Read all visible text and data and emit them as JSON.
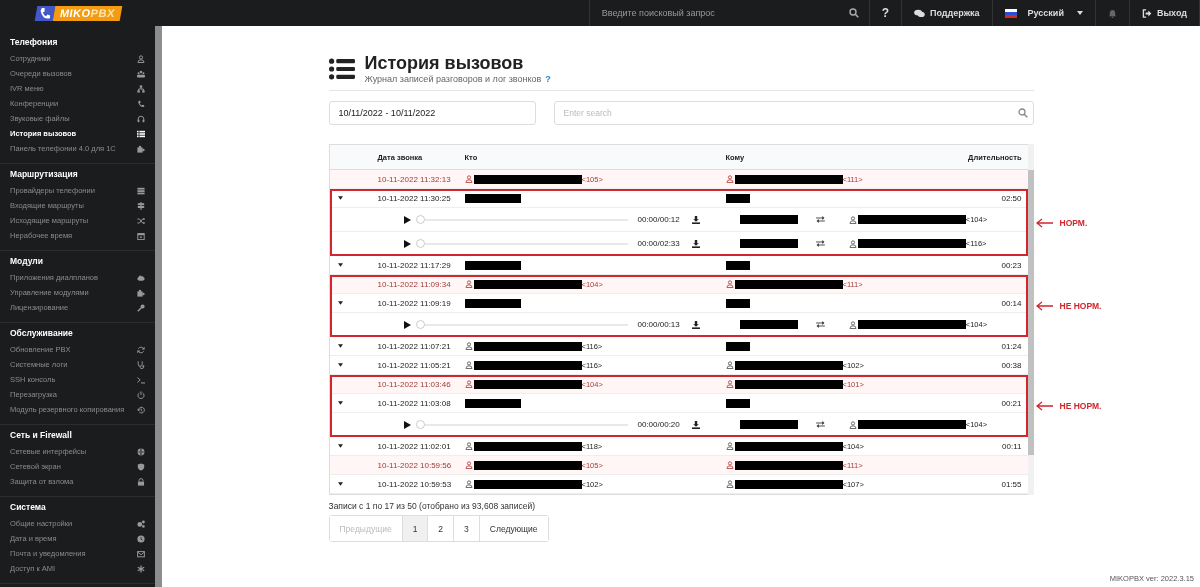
{
  "topbar": {
    "logo": {
      "left": "MIKO",
      "right": "PBX"
    },
    "search_placeholder": "Введите поисковый запрос",
    "help": "?",
    "support": "Поддержка",
    "language": "Русский",
    "logout": "Выход"
  },
  "sidebar": [
    {
      "title": "Телефония",
      "items": [
        {
          "label": "Сотрудники",
          "selected": false
        },
        {
          "label": "Очереди вызовов",
          "selected": false
        },
        {
          "label": "IVR меню",
          "selected": false
        },
        {
          "label": "Конференции",
          "selected": false
        },
        {
          "label": "Звуковые файлы",
          "selected": false
        },
        {
          "label": "История вызовов",
          "selected": true
        },
        {
          "label": "Панель телефонии 4.0 для 1С",
          "selected": false
        }
      ]
    },
    {
      "title": "Маршрутизация",
      "items": [
        {
          "label": "Провайдеры телефонии",
          "selected": false
        },
        {
          "label": "Входящие маршруты",
          "selected": false
        },
        {
          "label": "Исходящие маршруты",
          "selected": false
        },
        {
          "label": "Нерабочее время",
          "selected": false
        }
      ]
    },
    {
      "title": "Модули",
      "items": [
        {
          "label": "Приложения диалпланов",
          "selected": false
        },
        {
          "label": "Управление модулями",
          "selected": false
        },
        {
          "label": "Лицензирование",
          "selected": false
        }
      ]
    },
    {
      "title": "Обслуживание",
      "items": [
        {
          "label": "Обновление PBX",
          "selected": false
        },
        {
          "label": "Системные логи",
          "selected": false
        },
        {
          "label": "SSH консоль",
          "selected": false
        },
        {
          "label": "Перезагрузка",
          "selected": false
        },
        {
          "label": "Модуль резервного копирования",
          "selected": false
        }
      ]
    },
    {
      "title": "Сеть и Firewall",
      "items": [
        {
          "label": "Сетевые интерфейсы",
          "selected": false
        },
        {
          "label": "Сетевой экран",
          "selected": false
        },
        {
          "label": "Защита от взлома",
          "selected": false
        }
      ]
    },
    {
      "title": "Система",
      "items": [
        {
          "label": "Общие настройки",
          "selected": false
        },
        {
          "label": "Дата и время",
          "selected": false
        },
        {
          "label": "Почта и уведомления",
          "selected": false
        },
        {
          "label": "Доступ к AMI",
          "selected": false
        }
      ]
    }
  ],
  "page": {
    "title": "История вызовов",
    "subtitle": "Журнал записей разговоров и лог звонков",
    "help": "?"
  },
  "date_range": "10/11/2022 - 10/11/2022",
  "search": {
    "placeholder": "Enter search"
  },
  "table": {
    "columns": [
      "Дата звонка",
      "Кто",
      "Кому",
      "Длительность"
    ],
    "groups": [
      {
        "rows": [
          {
            "kind": "missed",
            "time": "10-11-2022 11:32:13",
            "from_user": true,
            "from_ext": "<105>",
            "to_user": true,
            "to_ext": "<111>"
          }
        ]
      },
      {
        "annotation": "НОРМ.",
        "rows": [
          {
            "kind": "call",
            "time": "10-11-2022 11:30:25",
            "from_user": false,
            "to_user": false,
            "duration": "02:50"
          },
          {
            "kind": "record",
            "position": "00:00/00:12",
            "level": 0,
            "to_user": true,
            "to_ext": "<104>"
          },
          {
            "kind": "record",
            "position": "00:00/02:33",
            "level": 0,
            "to_user": true,
            "to_ext": "<116>"
          }
        ]
      },
      {
        "rows": [
          {
            "kind": "call",
            "time": "10-11-2022 11:17:29",
            "from_user": false,
            "to_user": false,
            "duration": "00:23"
          }
        ]
      },
      {
        "annotation": "НЕ НОРМ.",
        "rows": [
          {
            "kind": "missed",
            "time": "10-11-2022 11:09:34",
            "from_user": true,
            "from_ext": "<104>",
            "to_user": true,
            "to_ext": "<111>"
          },
          {
            "kind": "call",
            "time": "10-11-2022 11:09:19",
            "from_user": false,
            "to_user": false,
            "duration": "00:14"
          },
          {
            "kind": "record",
            "position": "00:00/00:13",
            "level": 0,
            "to_user": true,
            "to_ext": "<104>"
          }
        ]
      },
      {
        "rows": [
          {
            "kind": "call",
            "time": "10-11-2022 11:07:21",
            "from_user": true,
            "from_ext": "<116>",
            "to_user": false,
            "duration": "01:24"
          },
          {
            "kind": "call",
            "time": "10-11-2022 11:05:21",
            "from_user": true,
            "from_ext": "<116>",
            "to_user": true,
            "to_ext": "<102>",
            "duration": "00:38"
          }
        ]
      },
      {
        "annotation": "НЕ НОРМ.",
        "rows": [
          {
            "kind": "missed",
            "time": "10-11-2022 11:03:46",
            "from_user": true,
            "from_ext": "<104>",
            "to_user": true,
            "to_ext": "<101>"
          },
          {
            "kind": "call",
            "time": "10-11-2022 11:03:08",
            "from_user": false,
            "to_user": false,
            "duration": "00:21"
          },
          {
            "kind": "record",
            "position": "00:00/00:20",
            "level": 0,
            "to_user": true,
            "to_ext": "<104>"
          }
        ]
      },
      {
        "rows": [
          {
            "kind": "call",
            "time": "10-11-2022 11:02:01",
            "from_user": true,
            "from_ext": "<118>",
            "to_user": true,
            "to_ext": "<104>",
            "duration": "00:11"
          },
          {
            "kind": "missed",
            "time": "10-11-2022 10:59:56",
            "from_user": true,
            "from_ext": "<105>",
            "to_user": true,
            "to_ext": "<111>"
          },
          {
            "kind": "call",
            "time": "10-11-2022 10:59:53",
            "from_user": true,
            "from_ext": "<102>",
            "to_user": true,
            "to_ext": "<107>",
            "duration": "01:55"
          }
        ]
      }
    ]
  },
  "summary": "Записи с 1 по 17 из 50 (отобрано из 93,608 записей)",
  "pagination": [
    {
      "label": "Предыдущие",
      "disabled": true,
      "selected": false
    },
    {
      "label": "1",
      "disabled": false,
      "selected": true
    },
    {
      "label": "2",
      "disabled": false,
      "selected": false
    },
    {
      "label": "3",
      "disabled": false,
      "selected": false
    },
    {
      "label": "Следующие",
      "disabled": false,
      "selected": false
    }
  ],
  "version": "MIKOPBX ver: 2022.3.15"
}
